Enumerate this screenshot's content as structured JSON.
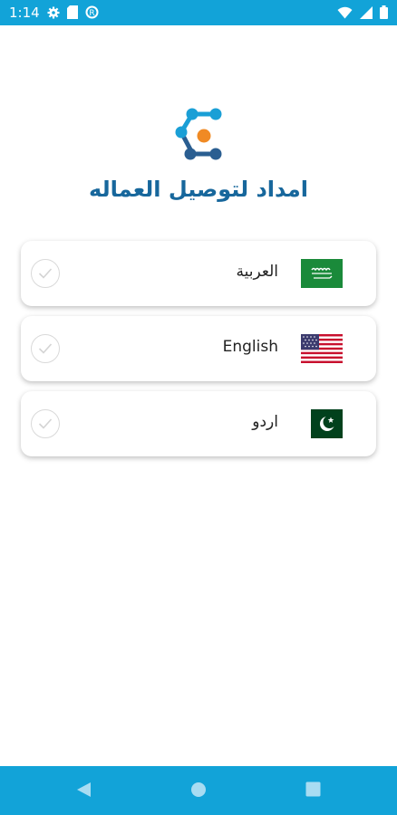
{
  "status_bar": {
    "time": "1:14",
    "left_icons": [
      "gear-icon",
      "sim-card-icon",
      "data-saver-icon"
    ],
    "right_icons": [
      "wifi-icon",
      "signal-icon",
      "battery-icon"
    ],
    "background": "#12a3d8"
  },
  "app": {
    "title": "امداد لتوصيل العماله",
    "title_color": "#17679c",
    "logo_colors": [
      "#1a9fd6",
      "#2a5e91",
      "#f08a24"
    ]
  },
  "languages": [
    {
      "label": "العربية",
      "flag": "saudi-arabia-flag",
      "selected": false
    },
    {
      "label": "English",
      "flag": "united-states-flag",
      "selected": false
    },
    {
      "label": "اردو",
      "flag": "pakistan-flag",
      "selected": false
    }
  ],
  "nav_bar": {
    "buttons": [
      "back-icon",
      "home-icon",
      "recents-icon"
    ],
    "background": "#12a3d8"
  }
}
